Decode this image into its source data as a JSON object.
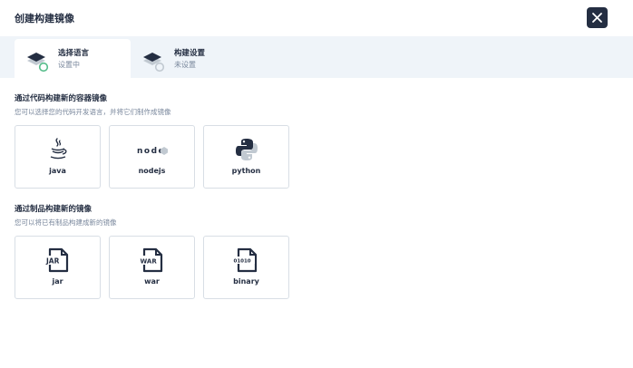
{
  "modal": {
    "title": "创建构建镜像"
  },
  "steps": [
    {
      "name": "选择语言",
      "status": "设置中"
    },
    {
      "name": "构建设置",
      "status": "未设置"
    }
  ],
  "sections": [
    {
      "title": "通过代码构建新的容器镜像",
      "description": "您可以选择您的代码开发语言，并将它们制作成镜像",
      "cards": [
        {
          "label": "java",
          "icon": "java-icon"
        },
        {
          "label": "nodejs",
          "icon": "nodejs-icon",
          "logo_text": "node"
        },
        {
          "label": "python",
          "icon": "python-icon"
        }
      ]
    },
    {
      "title": "通过制品构建新的镜像",
      "description": "您可以将已有制品构建成新的镜像",
      "cards": [
        {
          "label": "jar",
          "icon": "jar-file-icon",
          "badge": "JAR"
        },
        {
          "label": "war",
          "icon": "war-file-icon",
          "badge": "WAR"
        },
        {
          "label": "binary",
          "icon": "binary-file-icon",
          "badge": "01010"
        }
      ]
    }
  ],
  "colors": {
    "primary_dark": "#242e42",
    "muted_text": "#79879c",
    "steps_bg": "#eff4f9",
    "success_green": "#55bc8a",
    "card_border": "#d8dee5"
  }
}
